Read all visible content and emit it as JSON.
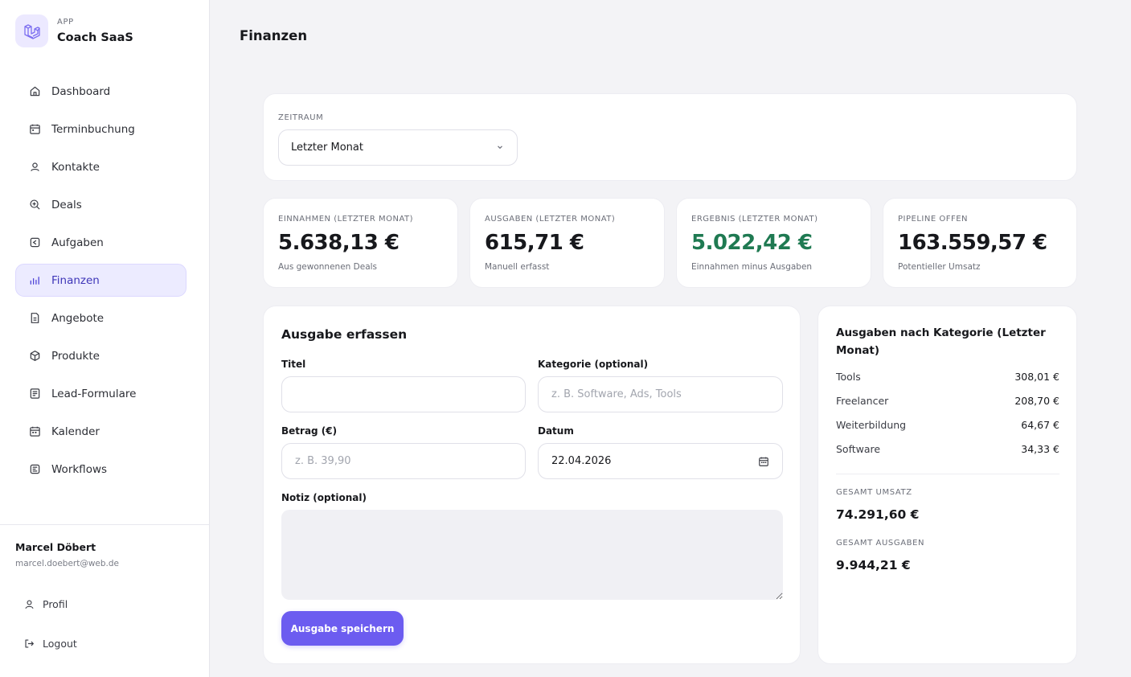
{
  "brand": {
    "small": "APP",
    "name": "Coach SaaS",
    "icon": "layers-logo-icon",
    "color": "#6c5cf0"
  },
  "nav": [
    {
      "label": "Dashboard",
      "icon": "home-icon"
    },
    {
      "label": "Terminbuchung",
      "icon": "calendar-icon"
    },
    {
      "label": "Kontakte",
      "icon": "user-icon"
    },
    {
      "label": "Deals",
      "icon": "search-plus-icon"
    },
    {
      "label": "Aufgaben",
      "icon": "task-icon"
    },
    {
      "label": "Finanzen",
      "icon": "bar-chart-icon",
      "active": true
    },
    {
      "label": "Angebote",
      "icon": "document-icon"
    },
    {
      "label": "Produkte",
      "icon": "box-icon"
    },
    {
      "label": "Lead-Formulare",
      "icon": "form-icon"
    },
    {
      "label": "Kalender",
      "icon": "calendar-icon"
    },
    {
      "label": "Workflows",
      "icon": "workflow-icon"
    }
  ],
  "user": {
    "name": "Marcel Döbert",
    "email": "marcel.doebert@web.de"
  },
  "side_links": {
    "profile": "Profil",
    "logout": "Logout"
  },
  "page": {
    "title": "Finanzen"
  },
  "period": {
    "caption": "ZEITRAUM",
    "value": "Letzter Monat"
  },
  "stats": [
    {
      "caption": "EINNAHMEN (LETZTER MONAT)",
      "value": "5.638,13 €",
      "sub": "Aus gewonnenen Deals"
    },
    {
      "caption": "AUSGABEN (LETZTER MONAT)",
      "value": "615,71 €",
      "sub": "Manuell erfasst"
    },
    {
      "caption": "ERGEBNIS (LETZTER MONAT)",
      "value": "5.022,42 €",
      "sub": "Einnahmen minus Ausgaben",
      "color": "#1f7a52"
    },
    {
      "caption": "PIPELINE OFFEN",
      "value": "163.559,57 €",
      "sub": "Potentieller Umsatz"
    }
  ],
  "form": {
    "title": "Ausgabe erfassen",
    "title_label": "Titel",
    "title_value": "",
    "category_label": "Kategorie (optional)",
    "category_placeholder": "z. B. Software, Ads, Tools",
    "amount_label": "Betrag (€)",
    "amount_placeholder": "z. B. 39,90",
    "date_label": "Datum",
    "date_value": "22.04.2026",
    "note_label": "Notiz (optional)",
    "note_value": "",
    "submit_label": "Ausgabe speichern"
  },
  "categories": {
    "title": "Ausgaben nach Kategorie (Letzter Monat)",
    "rows": [
      {
        "name": "Tools",
        "value": "308,01 €"
      },
      {
        "name": "Freelancer",
        "value": "208,70 €"
      },
      {
        "name": "Weiterbildung",
        "value": "64,67 €"
      },
      {
        "name": "Software",
        "value": "34,33 €"
      }
    ],
    "total_revenue_caption": "GESAMT UMSATZ",
    "total_revenue": "74.291,60 €",
    "total_expenses_caption": "GESAMT AUSGABEN",
    "total_expenses": "9.944,21 €"
  }
}
